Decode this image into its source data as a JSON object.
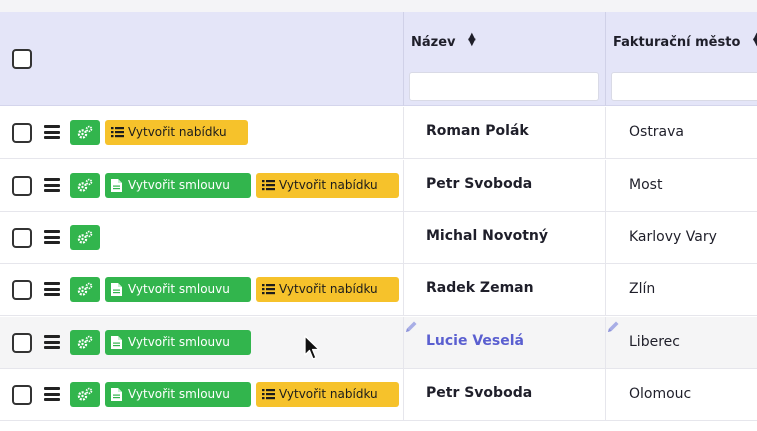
{
  "header": {
    "col_name": "Název",
    "col_city": "Fakturační město",
    "filter_name_value": "",
    "filter_city_value": ""
  },
  "icons": {
    "row_menu": "hamburger-menu-icon",
    "actions": "gears-icon",
    "contract": "document-icon",
    "offer": "list-icon",
    "edit": "pencil-icon",
    "cursor": "mouse-pointer-icon"
  },
  "colors": {
    "header_bg": "#e4e5f8",
    "action_green": "#32b54d",
    "offer_yellow": "#f6c22b",
    "link_blue": "#5a5fd0"
  },
  "rows": [
    {
      "name": "Roman Polák",
      "city": "Ostrava",
      "contract_label": "",
      "offer_label": "Vytvořit nabídku"
    },
    {
      "name": "Petr Svoboda",
      "city": "Most",
      "contract_label": "Vytvořit smlouvu",
      "offer_label": "Vytvořit nabídku"
    },
    {
      "name": "Michal Novotný",
      "city": "Karlovy Vary",
      "contract_label": "",
      "offer_label": ""
    },
    {
      "name": "Radek Zeman",
      "city": "Zlín",
      "contract_label": "Vytvořit smlouvu",
      "offer_label": "Vytvořit nabídku"
    },
    {
      "name": "Lucie Veselá",
      "city": "Liberec",
      "contract_label": "Vytvořit smlouvu",
      "offer_label": ""
    },
    {
      "name": "Petr Svoboda",
      "city": "Olomouc",
      "contract_label": "Vytvořit smlouvu",
      "offer_label": "Vytvořit nabídku"
    }
  ]
}
